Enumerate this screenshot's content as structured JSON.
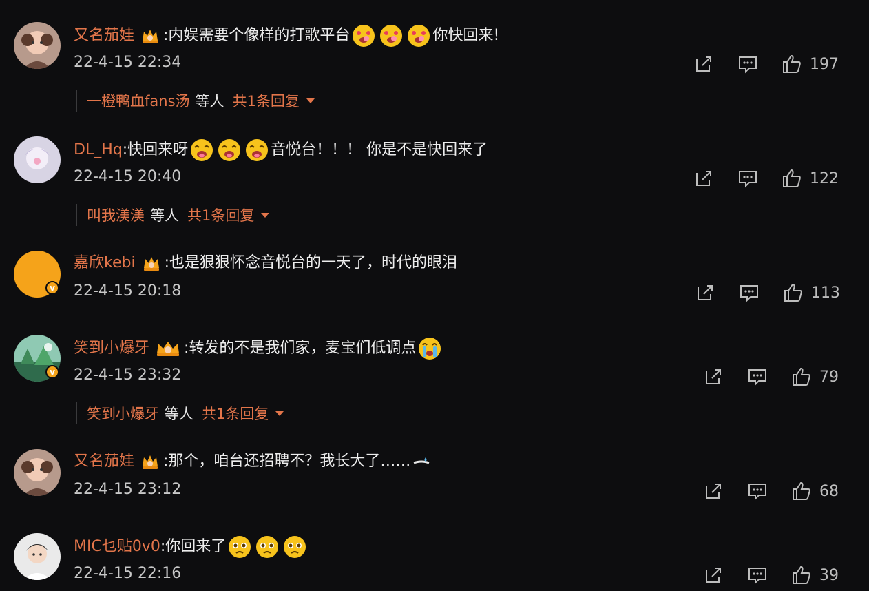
{
  "comments": [
    {
      "username": "又名茄娃",
      "text_before": ":内娱需要个像样的打歌平台",
      "text_after": "你快回来!",
      "time": "22-4-15 22:34",
      "likes": "197",
      "emoji": "lovestruck-face",
      "reply": {
        "name": "一橙鸭血fans汤",
        "mid": "等人",
        "total": "共1条回复"
      }
    },
    {
      "username": "DL_Hq",
      "text_before": ":快回来呀",
      "text_after": "音悦台！！！ 你是不是快回来了",
      "time": "22-4-15 20:40",
      "likes": "122",
      "emoji": "drooling-face",
      "reply": {
        "name": "叫我渼渼",
        "mid": "等人",
        "total": "共1条回复"
      }
    },
    {
      "username": "嘉欣kebi",
      "text_before": ":也是狠狠怀念音悦台的一天了，时代的眼泪",
      "time": "22-4-15 20:18",
      "likes": "113"
    },
    {
      "username": "笑到小爆牙",
      "text_before": ":转发的不是我们家，麦宝们低调点",
      "time": "22-4-15 23:32",
      "likes": "79",
      "emoji": "crying-face",
      "reply": {
        "name": "笑到小爆牙",
        "mid": "等人",
        "total": "共1条回复"
      }
    },
    {
      "username": "又名茄娃",
      "text_before": ":那个，咱台还招聘不？我长大了……",
      "time": "22-4-15 23:12",
      "likes": "68",
      "emoji": "sweat-icon"
    },
    {
      "username": "MIC乜贴0v0",
      "text_before": ":你回来了",
      "time": "22-4-15 22:16",
      "likes": "39",
      "emoji": "pleading-face"
    }
  ],
  "colors": {
    "background": "#0d0d0f",
    "username": "#e2754a",
    "text": "#ededed",
    "meta": "#c8c8c8"
  }
}
